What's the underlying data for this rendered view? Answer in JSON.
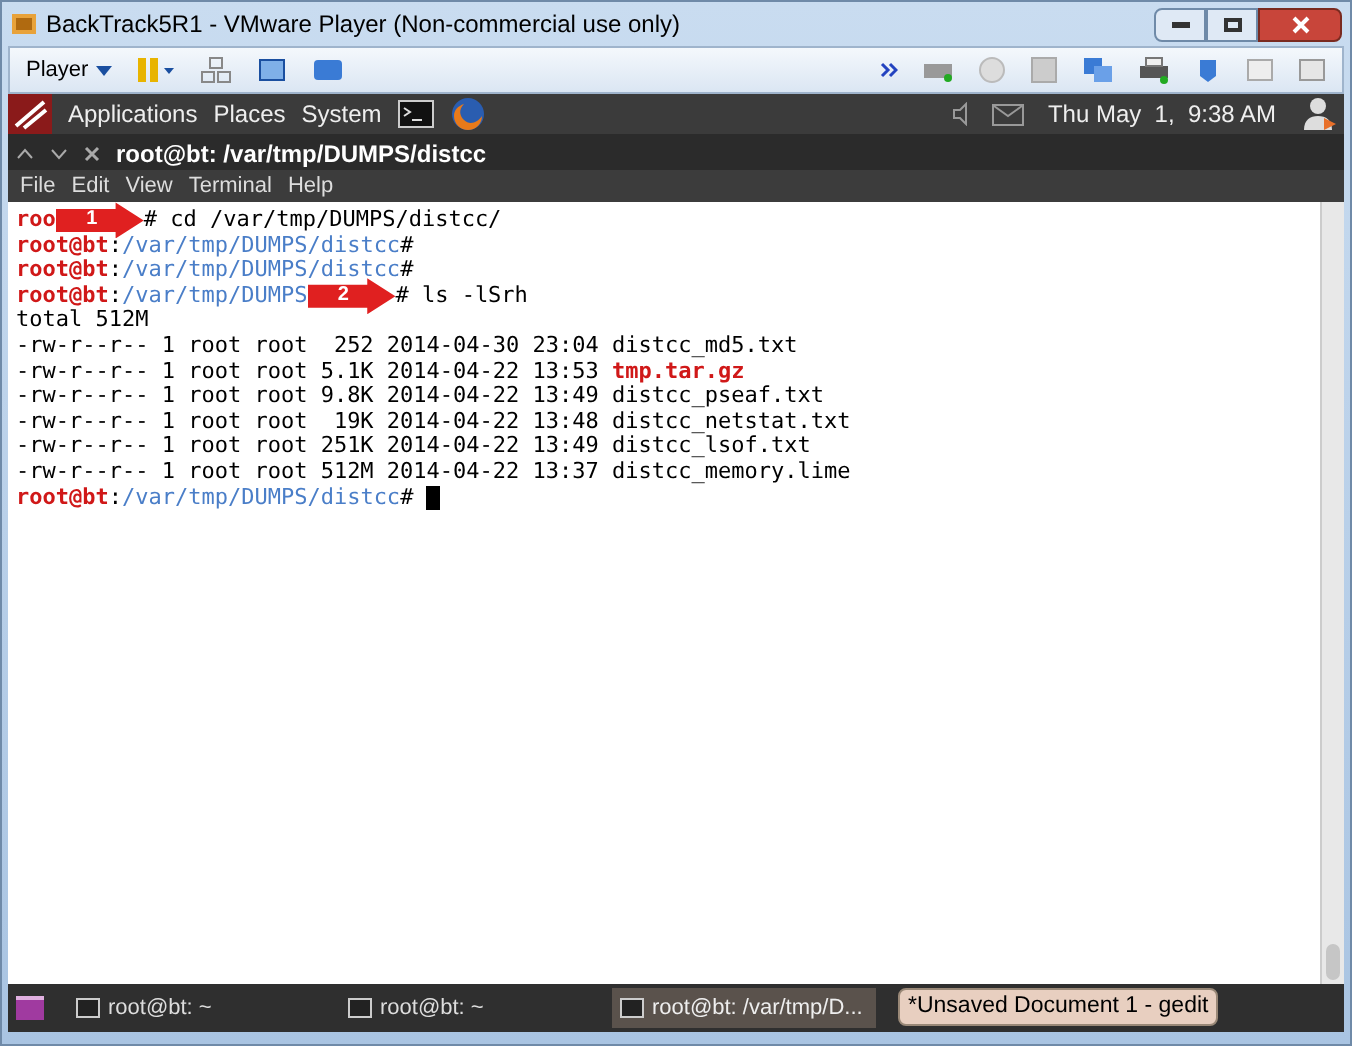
{
  "window": {
    "title": "BackTrack5R1 - VMware Player (Non-commercial use only)"
  },
  "toolbar": {
    "player_menu": "Player"
  },
  "top_panel": {
    "menus": [
      "Applications",
      "Places",
      "System"
    ],
    "clock": "Thu May  1,  9:38 AM"
  },
  "terminal": {
    "tab_title": "root@bt: /var/tmp/DUMPS/distcc",
    "menu": [
      "File",
      "Edit",
      "View",
      "Terminal",
      "Help"
    ],
    "lines": [
      {
        "segments": [
          {
            "kind": "user",
            "text": "roo"
          },
          {
            "kind": "callout",
            "label": "1"
          },
          {
            "kind": "plain",
            "text": "# cd /var/tmp/DUMPS/distcc/"
          }
        ]
      },
      {
        "segments": [
          {
            "kind": "user",
            "text": "root@bt"
          },
          {
            "kind": "plain",
            "text": ":"
          },
          {
            "kind": "path",
            "text": "/var/tmp/DUMPS/distcc"
          },
          {
            "kind": "plain",
            "text": "#"
          }
        ]
      },
      {
        "segments": [
          {
            "kind": "user",
            "text": "root@bt"
          },
          {
            "kind": "plain",
            "text": ":"
          },
          {
            "kind": "path",
            "text": "/var/tmp/DUMPS/distcc"
          },
          {
            "kind": "plain",
            "text": "#"
          }
        ]
      },
      {
        "segments": [
          {
            "kind": "user",
            "text": "root@bt"
          },
          {
            "kind": "plain",
            "text": ":"
          },
          {
            "kind": "path",
            "text": "/var/tmp/DUMPS"
          },
          {
            "kind": "callout",
            "label": "2"
          },
          {
            "kind": "plain",
            "text": "# ls -lSrh"
          }
        ]
      },
      {
        "segments": [
          {
            "kind": "plain",
            "text": "total 512M"
          }
        ]
      },
      {
        "segments": [
          {
            "kind": "plain",
            "text": "-rw-r--r-- 1 root root  252 2014-04-30 23:04 distcc_md5.txt"
          }
        ]
      },
      {
        "segments": [
          {
            "kind": "plain",
            "text": "-rw-r--r-- 1 root root 5.1K 2014-04-22 13:53 "
          },
          {
            "kind": "archive",
            "text": "tmp.tar.gz"
          }
        ]
      },
      {
        "segments": [
          {
            "kind": "plain",
            "text": "-rw-r--r-- 1 root root 9.8K 2014-04-22 13:49 distcc_pseaf.txt"
          }
        ]
      },
      {
        "segments": [
          {
            "kind": "plain",
            "text": "-rw-r--r-- 1 root root  19K 2014-04-22 13:48 distcc_netstat.txt"
          }
        ]
      },
      {
        "segments": [
          {
            "kind": "plain",
            "text": "-rw-r--r-- 1 root root 251K 2014-04-22 13:49 distcc_lsof.txt"
          }
        ]
      },
      {
        "segments": [
          {
            "kind": "plain",
            "text": "-rw-r--r-- 1 root root 512M 2014-04-22 13:37 distcc_memory.lime"
          }
        ]
      },
      {
        "segments": [
          {
            "kind": "user",
            "text": "root@bt"
          },
          {
            "kind": "plain",
            "text": ":"
          },
          {
            "kind": "path",
            "text": "/var/tmp/DUMPS/distcc"
          },
          {
            "kind": "plain",
            "text": "# "
          },
          {
            "kind": "cursor"
          }
        ]
      }
    ]
  },
  "taskbar": {
    "items": [
      {
        "label": "root@bt: ~",
        "selected": false
      },
      {
        "label": "root@bt: ~",
        "selected": false
      },
      {
        "label": "root@bt: /var/tmp/D...",
        "selected": true
      }
    ],
    "tooltip": "*Unsaved Document 1 - gedit"
  }
}
